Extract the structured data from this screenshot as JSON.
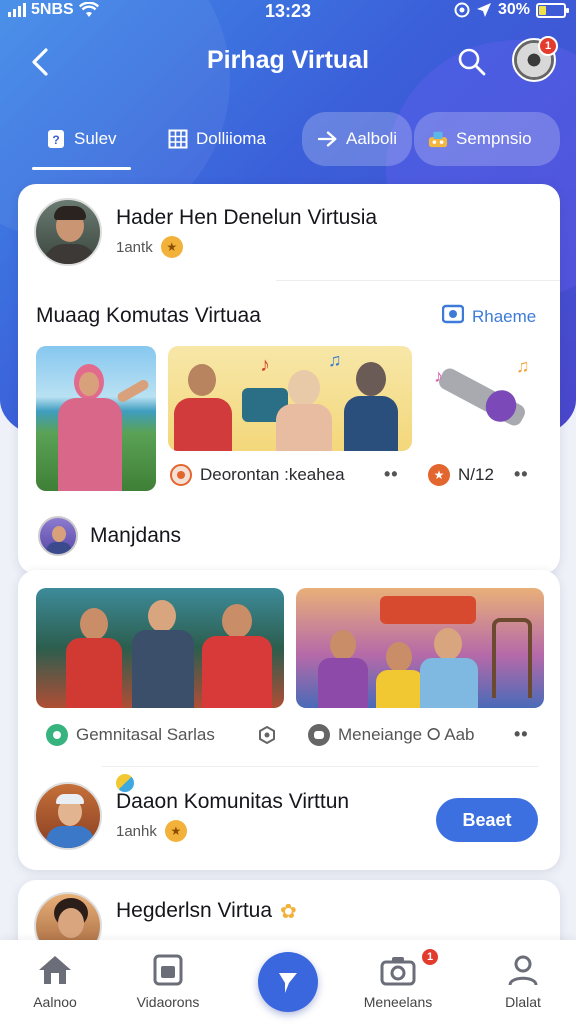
{
  "status_bar": {
    "carrier": "5NBS",
    "time": "13:23",
    "battery": "30%",
    "battery_level": 0.3
  },
  "header": {
    "title": "Pirhag Virtual",
    "notification_count": "1"
  },
  "tabs": [
    {
      "label": "Sulev",
      "icon": "bookmark-icon"
    },
    {
      "label": "Dolliioma",
      "icon": "grid-icon"
    },
    {
      "label": "Aalboli",
      "icon": "send-icon"
    },
    {
      "label": "Sempnsio",
      "icon": "game-icon"
    }
  ],
  "card1": {
    "profile": {
      "name": "Hader Hen Denelun Virtusia",
      "sub": "1antk"
    },
    "section_title": "Muaag Komutas Virtuaa",
    "section_link": "Rhaeme",
    "items": [
      {
        "label": "Deorontan :keahea"
      },
      {
        "label": "N/12"
      }
    ],
    "member": {
      "name": "Manjdans"
    }
  },
  "feed_items": [
    {
      "label": "Gemnitasal Sarlas"
    },
    {
      "label": "Meneiange ⭘ Aab"
    }
  ],
  "community": {
    "name": "Daaon Komunitas Virttun",
    "sub": "1anhk",
    "button": "Beaet"
  },
  "next_card": {
    "name": "Hegderlsn Virtua"
  },
  "bottom_nav": [
    {
      "label": "Aalnoo",
      "icon": "home-icon"
    },
    {
      "label": "Vidaorons",
      "icon": "video-icon"
    },
    {
      "label": "",
      "icon": "chat-icon"
    },
    {
      "label": "Meneelans",
      "icon": "camera-icon",
      "badge": "1"
    },
    {
      "label": "Dlalat",
      "icon": "profile-icon"
    }
  ]
}
